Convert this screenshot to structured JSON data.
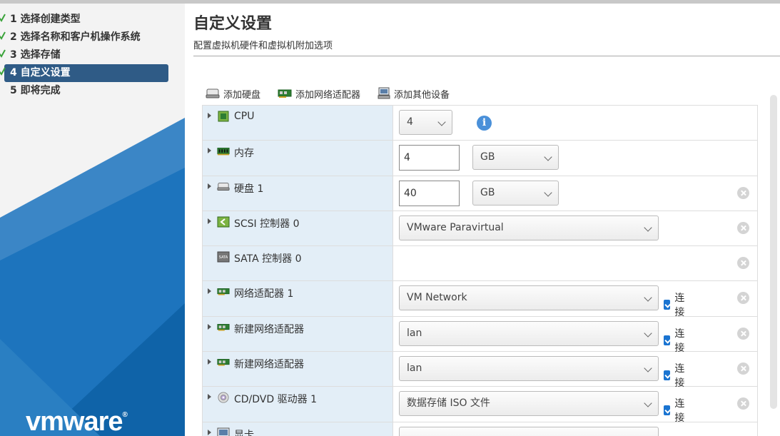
{
  "wizard": {
    "steps": [
      {
        "label": "1 选择创建类型",
        "completed": true
      },
      {
        "label": "2 选择名称和客户机操作系统",
        "completed": true
      },
      {
        "label": "3 选择存储",
        "completed": true
      },
      {
        "label": "4 自定义设置",
        "completed": true,
        "active": true
      },
      {
        "label": "5 即将完成",
        "completed": false
      }
    ],
    "logo": "vmware"
  },
  "header": {
    "title": "自定义设置",
    "subtitle": "配置虚拟机硬件和虚拟机附加选项"
  },
  "toolbar": {
    "add_disk": "添加硬盘",
    "add_network": "添加网络适配器",
    "add_other": "添加其他设备"
  },
  "hardware": {
    "cpu": {
      "label": "CPU",
      "value": "4",
      "icon": "cpu-icon"
    },
    "memory": {
      "label": "内存",
      "value": "4",
      "unit": "GB",
      "icon": "memory-icon"
    },
    "disk1": {
      "label": "硬盘 1",
      "value": "40",
      "unit": "GB",
      "icon": "disk-icon"
    },
    "scsi0": {
      "label": "SCSI 控制器 0",
      "value": "VMware Paravirtual",
      "icon": "scsi-icon"
    },
    "sata0": {
      "label": "SATA 控制器 0",
      "icon": "sata-icon"
    },
    "nic1": {
      "label": "网络适配器 1",
      "value": "VM Network",
      "connect_label": "连接",
      "connected": true
    },
    "nic2": {
      "label": "新建网络适配器",
      "value": "lan",
      "connect_label": "连接",
      "connected": true
    },
    "nic3": {
      "label": "新建网络适配器",
      "value": "lan",
      "connect_label": "连接",
      "connected": true
    },
    "cdrom1": {
      "label": "CD/DVD 驱动器 1",
      "value": "数据存储 ISO 文件",
      "connect_label": "连接",
      "connected": true
    },
    "video": {
      "label": "显卡"
    }
  },
  "colors": {
    "active_step": "#2f5b86",
    "label_bg": "#e3eef7",
    "checkbox": "#1a74d1",
    "brand_blue": "#1d74bd"
  }
}
